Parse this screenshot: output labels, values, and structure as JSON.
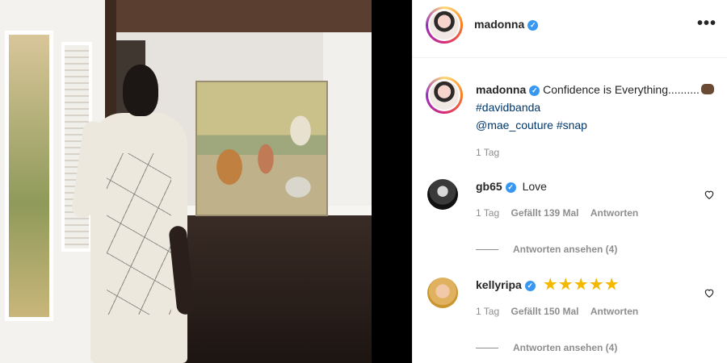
{
  "post": {
    "username": "madonna",
    "more_icon": "more-horizontal-icon"
  },
  "caption": {
    "username": "madonna",
    "text": "Confidence is Everything..........",
    "emoji": "fist-bump-emoji",
    "hashtag1": "#davidbanda",
    "mention": "@mae_couture",
    "hashtag2": "#snap",
    "time": "1 Tag"
  },
  "comments": [
    {
      "username": "gb65",
      "text": "Love",
      "time": "1 Tag",
      "likes": "Gefällt 139 Mal",
      "reply_label": "Antworten",
      "view_replies": "Antworten ansehen (4)"
    },
    {
      "username": "kellyripa",
      "text": "",
      "star_count": 5,
      "time": "1 Tag",
      "likes": "Gefällt 150 Mal",
      "reply_label": "Antworten",
      "view_replies": "Antworten ansehen (4)"
    }
  ],
  "colors": {
    "verified": "#3897f0",
    "link": "#00376b",
    "meta_gray": "#8e8e8e"
  }
}
